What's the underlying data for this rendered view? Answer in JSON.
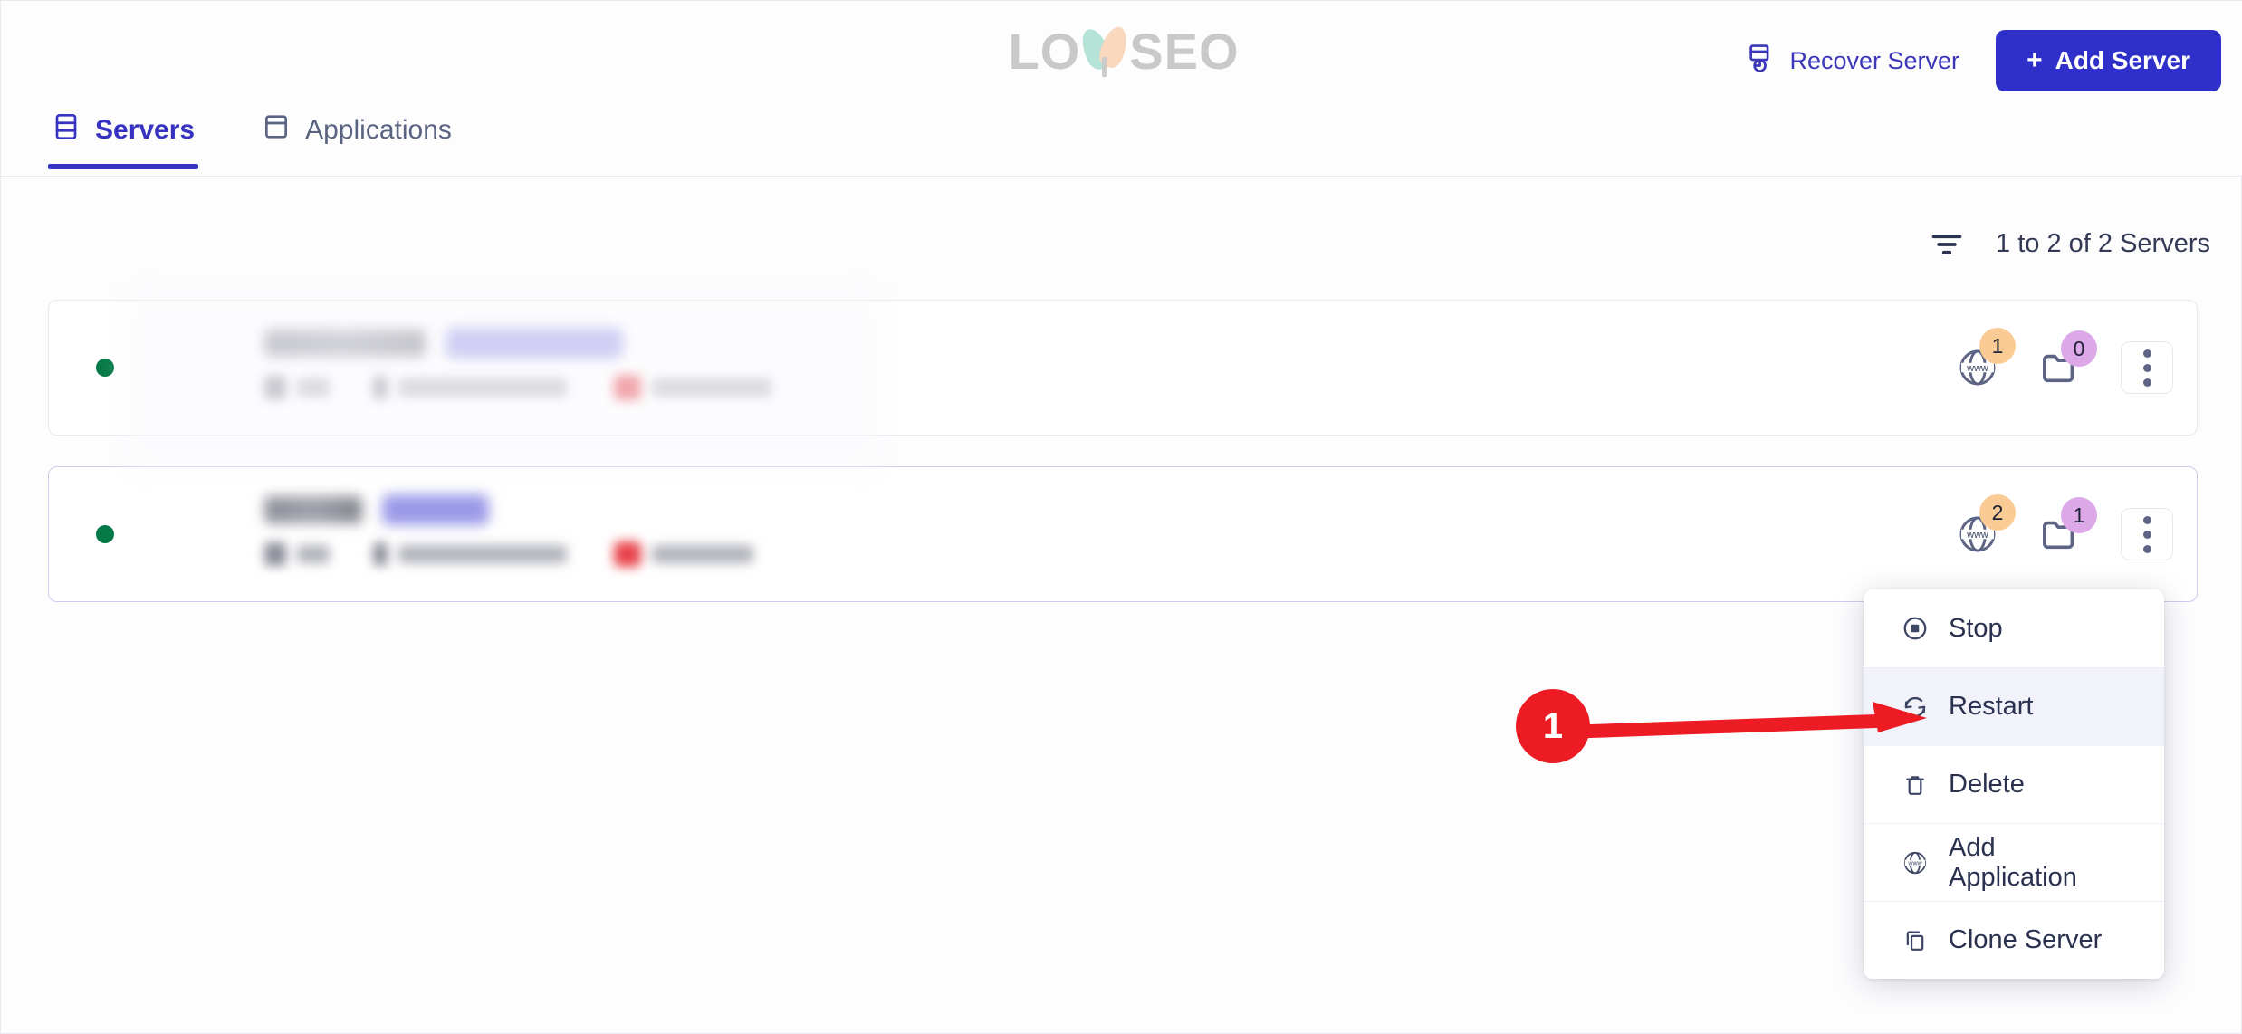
{
  "app": {
    "logo_text_left": "LO",
    "logo_text_right": "SEO",
    "logo_name": "LOYSEO"
  },
  "header": {
    "recover_label": "Recover Server",
    "recover_icon": "server-restore-icon",
    "add_label": "Add Server",
    "add_plus": "+",
    "add_button_color": "#2f30c9"
  },
  "tabs": [
    {
      "label": "Servers",
      "icon": "server-stack-icon",
      "active": true
    },
    {
      "label": "Applications",
      "icon": "window-icon",
      "active": false
    }
  ],
  "toolbar": {
    "filter_icon": "filter-icon",
    "count_text": "1 to 2 of 2 Servers"
  },
  "servers": [
    {
      "status": "running",
      "status_color": "#067a46",
      "provider_icon": "vultr-shield-icon",
      "name_redacted": true,
      "badge_redacted": true,
      "web_apps_count": "1",
      "web_apps_badge_color": "#fbcb95",
      "folders_count": "0",
      "folders_badge_color": "#dda8e8",
      "kebab_icon": "more-vertical-icon",
      "selected": false
    },
    {
      "status": "running",
      "status_color": "#067a46",
      "provider_icon": "digitalocean-circle-icon",
      "name_redacted": true,
      "badge_redacted": true,
      "web_apps_count": "2",
      "web_apps_badge_color": "#fbcb95",
      "folders_count": "1",
      "folders_badge_color": "#dda8e8",
      "kebab_icon": "more-vertical-icon",
      "selected": true
    }
  ],
  "context_menu": {
    "items": [
      {
        "label": "Stop",
        "icon": "stop-circle-icon",
        "highlight": false
      },
      {
        "label": "Restart",
        "icon": "restart-icon",
        "highlight": true
      },
      {
        "label": "Delete",
        "icon": "trash-icon",
        "highlight": false
      },
      {
        "label": "Add Application",
        "icon": "www-globe-icon",
        "highlight": false
      },
      {
        "label": "Clone Server",
        "icon": "copy-icon",
        "highlight": false
      }
    ]
  },
  "annotation": {
    "step_number": "1",
    "color": "#ed1c24",
    "points_to": "Restart"
  }
}
